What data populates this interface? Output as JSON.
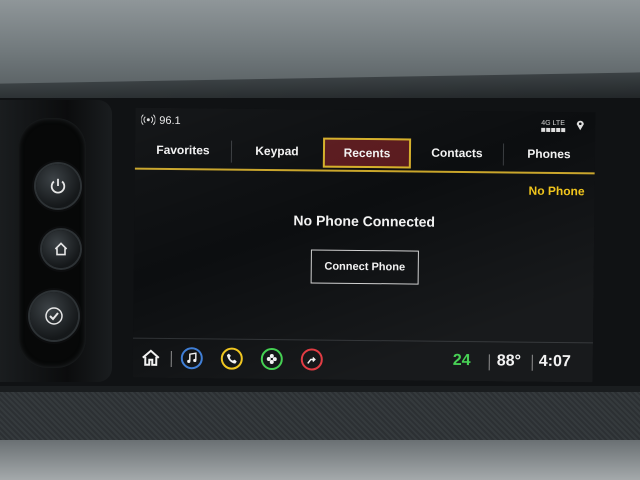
{
  "status_bar": {
    "radio_icon": "radio-tower-icon",
    "radio_frequency": "96.1",
    "network": "4G LTE",
    "location_icon": "location-pin-icon"
  },
  "tabs": [
    {
      "label": "Favorites",
      "active": false
    },
    {
      "label": "Keypad",
      "active": false
    },
    {
      "label": "Recents",
      "active": true
    },
    {
      "label": "Contacts",
      "active": false
    },
    {
      "label": "Phones",
      "active": false
    }
  ],
  "phone_status": "No Phone",
  "main": {
    "message": "No Phone Connected",
    "connect_button": "Connect Phone"
  },
  "bottom_bar": {
    "apps": [
      {
        "name": "music-icon",
        "color": "#3a7bd5"
      },
      {
        "name": "phone-icon",
        "color": "#f0c419"
      },
      {
        "name": "apps-icon",
        "color": "#3ecf4c"
      },
      {
        "name": "navigation-icon",
        "color": "#e0343c"
      }
    ],
    "climate_value": "24",
    "climate_color": "#3ecf4c",
    "outside_temp": "88°",
    "time": "4:07"
  },
  "colors": {
    "accent_yellow": "#f0c419",
    "active_tab_bg": "#5a1a1e",
    "active_tab_border": "#d4b02a"
  }
}
